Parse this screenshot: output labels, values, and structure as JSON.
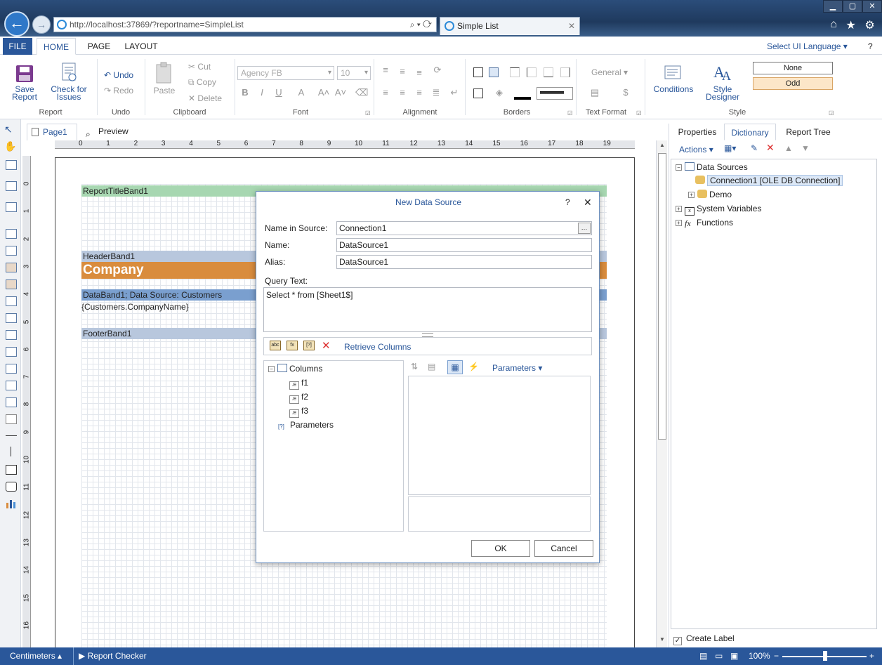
{
  "browser": {
    "address": "http://localhost:37869/?reportname=SimpleList",
    "tab_title": "Simple List",
    "tab_close": "✕",
    "address_tools": "⌕ ▾ ⟳",
    "back_icon": "arrow-left-icon",
    "forward_icon": "arrow-right-icon"
  },
  "ribbon": {
    "file": "FILE",
    "tabs": [
      "HOME",
      "PAGE",
      "LAYOUT"
    ],
    "ui_language": "Select UI Language",
    "help": "?",
    "groups": {
      "report": "Report",
      "undo": "Undo",
      "clipboard": "Clipboard",
      "font": "Font",
      "alignment": "Alignment",
      "borders": "Borders",
      "text_format": "Text Format",
      "style": "Style"
    },
    "save_report": [
      "Save",
      "Report"
    ],
    "check_issues": [
      "Check for",
      "Issues"
    ],
    "undo": "Undo",
    "redo": "Redo",
    "paste": "Paste",
    "cut": "Cut",
    "copy": "Copy",
    "delete": "Delete",
    "font_name": "Agency FB",
    "font_size": "10",
    "bold": "B",
    "italic": "I",
    "underline": "U",
    "general": "General",
    "conditions": "Conditions",
    "style_designer": [
      "Style",
      "Designer"
    ],
    "style_none": "None",
    "style_odd": "Odd"
  },
  "designer": {
    "page_tab": "Page1",
    "preview_tab": "Preview",
    "ruler_h": [
      "0",
      "1",
      "2",
      "3",
      "4",
      "5",
      "6",
      "7",
      "8",
      "9",
      "10",
      "11",
      "12",
      "13",
      "14",
      "15",
      "16",
      "17",
      "18",
      "19"
    ],
    "ruler_v": [
      "0",
      "1",
      "2",
      "3",
      "4",
      "5",
      "6",
      "7",
      "8",
      "9",
      "10",
      "11",
      "12",
      "13",
      "14",
      "15",
      "16"
    ],
    "bands": {
      "report_title": "ReportTitleBand1",
      "header": "HeaderBand1",
      "company": "Company",
      "data": "DataBand1; Data Source: Customers",
      "company_field": "{Customers.CompanyName}",
      "footer": "FooterBand1"
    }
  },
  "right_panel": {
    "tabs": [
      "Properties",
      "Dictionary",
      "Report Tree"
    ],
    "actions": "Actions",
    "tree": {
      "data_sources": "Data Sources",
      "connection": "Connection1 [OLE DB Connection]",
      "demo": "Demo",
      "system_variables": "System Variables",
      "functions": "Functions"
    },
    "create_label": "Create Label",
    "create_label_checked": true
  },
  "status": {
    "units": "Centimeters",
    "checker": "Report Checker",
    "zoom": "100%"
  },
  "dialog": {
    "title": "New Data Source",
    "help": "?",
    "close": "✕",
    "name_in_source_label": "Name in Source:",
    "name_in_source": "Connection1",
    "name_label": "Name:",
    "name": "DataSource1",
    "alias_label": "Alias:",
    "alias": "DataSource1",
    "query_label": "Query Text:",
    "query": "Select * from [Sheet1$]",
    "retrieve_columns": "Retrieve Columns",
    "columns": "Columns",
    "column_items": [
      "f1",
      "f2",
      "f3"
    ],
    "parameters": "Parameters",
    "parameters_dropdown": "Parameters",
    "ok": "OK",
    "cancel": "Cancel"
  },
  "colors": {
    "accent": "#2a579a",
    "report_title_band": "#a7d7b1",
    "header_band": "#b8c7dd",
    "company_fill": "#d98c3d",
    "data_band": "#7a9fcf"
  }
}
